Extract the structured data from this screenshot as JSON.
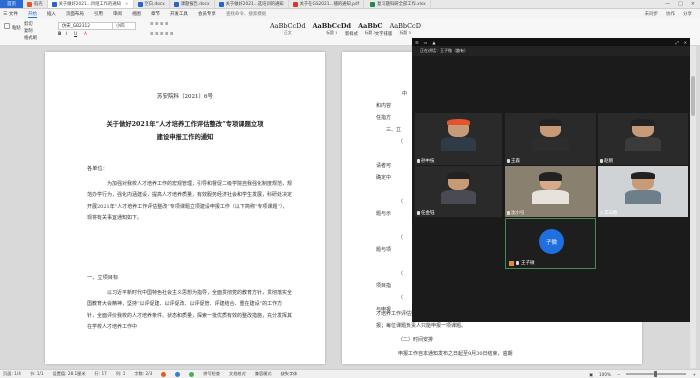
{
  "tabs": {
    "home": "首页",
    "items": [
      {
        "label": "稻壳",
        "icon": "daoke-icon"
      },
      {
        "label": "关于做好2021...目组工作的通知",
        "icon": "word-file-icon",
        "active": true
      },
      {
        "label": "空白.docx",
        "icon": "word-file-icon"
      },
      {
        "label": "课题报告.docx",
        "icon": "word-file-icon"
      },
      {
        "label": "关于做好2021...选培训的通知",
        "icon": "word-file-icon"
      },
      {
        "label": "关于在GS2021...播的通知.pdf",
        "icon": "pdf-file-icon"
      },
      {
        "label": "复习题科研全部工作.xlsx",
        "icon": "excel-file-icon"
      }
    ]
  },
  "menu": {
    "items": [
      "三 文件",
      "开始",
      "插入",
      "页面布局",
      "引用",
      "审阅",
      "视图",
      "章节",
      "开发工具",
      "会员专享"
    ],
    "active": "开始",
    "search": "查找命令、搜索模板",
    "right": [
      "未同步",
      "协作",
      "分享"
    ]
  },
  "ribbon": {
    "paste": "粘贴",
    "cut": "剪切",
    "copy": "复制",
    "format_painter": "格式刷",
    "font": "仿宋_GB2312",
    "size": "小四",
    "styles": [
      {
        "preview": "AaBbCcDd",
        "name": "正文"
      },
      {
        "preview": "AaBbCcDd",
        "name": "标题 1"
      },
      {
        "preview": "AaBbC",
        "name": "标题 2"
      },
      {
        "preview": "AaBbCcD",
        "name": "标题 3"
      }
    ],
    "more": [
      "新样式",
      "文字排版",
      "查找替换",
      "选择"
    ]
  },
  "document": {
    "doc_number": "苏安院科〔2021〕6号",
    "title_line1": "关于做好2021年“人才培养工作评估整改”专项课题立项",
    "title_line2": "建设申报工作的通知",
    "salutation": "各单位：",
    "body": "为加强对我校人才培养工作的宏观管理，引导和督促二级学院自我强化制度规范，规范办学行为，强化内涵建设，提高人才培养质量，有效服务经济社会和学生发展，科研处决定开展2021年“人才培养工作评估整改”专项课题立项建设申报工作（以下简称“专项课题”），现将有关事宜通知如下。",
    "section1": "一、立项目标",
    "section1_body": "以习近平新时代中国特色社会主义思想为指导，全面贯彻党的教育方针，贯彻落实全国教育大会精神，坚持“以评促建、以评促改、以评促管、评建结合、重在建设”的工作方针，全面评价我校的人才培养条件、状态和质量，探索一批优质有效的整改措施，充分发挥其在学校人才培养工作中"
  },
  "page2": {
    "lines": [
      "中",
      "和内容",
      "任指方",
      "三、立",
      "（",
      "请者可",
      "确定中",
      "（",
      "题与示",
      "（",
      "题与项",
      "（",
      "项目指",
      "（",
      "与申报"
    ],
    "tail1": "才培养工作评估整改”专项课题申报，原则上每个申",
    "tail2": "报；每位课题负责人只能申报一项课题。",
    "tail3": "（二）时间安排",
    "tail4": "申报工作自本通知发布之日起至9月30日结束，逾期"
  },
  "meeting": {
    "title": "正在讲话：王子微（趣有）",
    "participants": [
      {
        "name": "孙中技",
        "shirt": "#2f3b46"
      },
      {
        "name": "王森",
        "shirt": "#2d2d2d"
      },
      {
        "name": "赵刚",
        "shirt": "#3b3b3b"
      },
      {
        "name": "任金钰",
        "shirt": "#4a4a55"
      },
      {
        "name": "沈小引",
        "shirt": "#e8e2dc"
      },
      {
        "name": "李白胜",
        "shirt": "#6d7f8a"
      }
    ],
    "speaker": {
      "name": "王子微",
      "avatar_text": "子微"
    }
  },
  "status_bar": {
    "page": "页面: 1/4",
    "section": "节: 1/1",
    "position": "设置值: 28.1厘米",
    "row": "行: 17",
    "col": "列: 1",
    "words": "字数: 2/3",
    "spell": "拼写检查",
    "proof": "文档校对",
    "mode": "兼容模式",
    "missing_font": "缺失字体",
    "zoom": "100%"
  },
  "colors": {
    "accent": "#2b6cd4",
    "speaker_border": "#3f8f50",
    "avatar": "#1f6fe0"
  }
}
